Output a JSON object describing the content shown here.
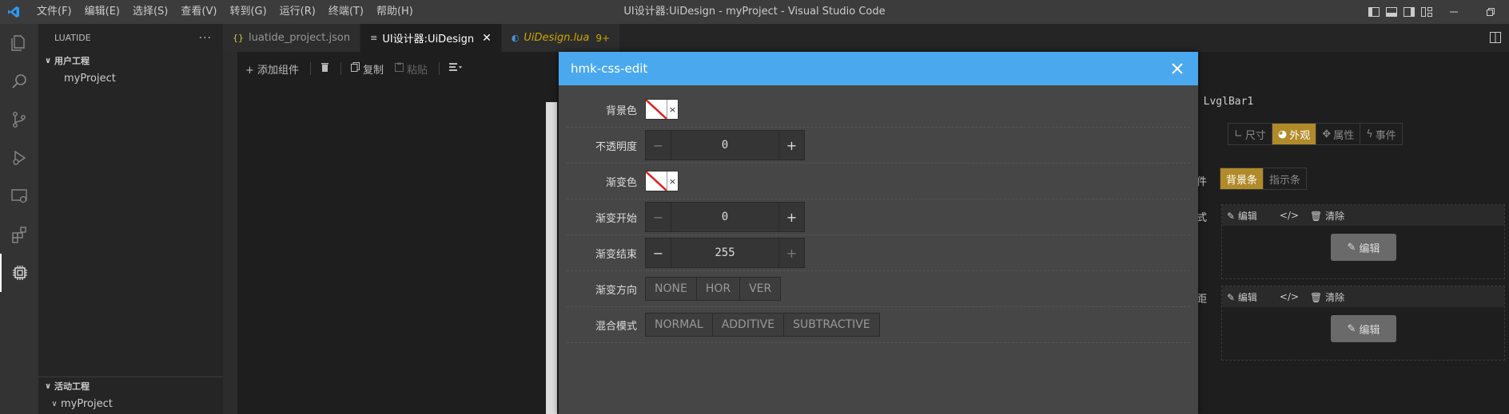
{
  "window": {
    "title": "UI设计器:UiDesign - myProject - Visual Studio Code"
  },
  "menu": [
    "文件(F)",
    "编辑(E)",
    "选择(S)",
    "查看(V)",
    "转到(G)",
    "运行(R)",
    "终端(T)",
    "帮助(H)"
  ],
  "sidebar": {
    "header": "LUATIDE",
    "more": "···",
    "section1": "用户工程",
    "project1": "myProject",
    "section2": "活动工程",
    "project2": "myProject"
  },
  "tabs": [
    {
      "icon": "{}",
      "label": "luatide_project.json"
    },
    {
      "icon": "≡",
      "label": "UI设计器:UiDesign",
      "close": "✕"
    },
    {
      "icon": "◐",
      "label": "UiDesign.lua",
      "badge": "9+"
    }
  ],
  "toolbar": {
    "add": "+ 添加组件",
    "copy": "复制",
    "paste": "粘贴"
  },
  "right_panel": {
    "title": ": LvglBar1",
    "tabs": [
      "尺寸",
      "外观",
      "属性",
      "事件"
    ],
    "active_tab": "外观",
    "part_label": "件",
    "parts": [
      "背景条",
      "指示条"
    ],
    "active_part": "背景条",
    "style_label": "式",
    "pad_label": "距",
    "bar_edit": "编辑",
    "bar_code": "</>",
    "bar_clear": "清除",
    "edit_btn": "编辑"
  },
  "modal": {
    "title": "hmk-css-edit",
    "rows": {
      "bg_color": "背景色",
      "opacity": "不透明度",
      "grad_color": "渐变色",
      "grad_start": "渐变开始",
      "grad_end": "渐变结束",
      "grad_dir": "渐变方向",
      "blend_mode": "混合模式"
    },
    "values": {
      "opacity": "0",
      "grad_start": "0",
      "grad_end": "255"
    },
    "swatch_clear": "×",
    "minus": "−",
    "plus": "+",
    "grad_dir_options": [
      "NONE",
      "HOR",
      "VER"
    ],
    "blend_options": [
      "NORMAL",
      "ADDITIVE",
      "SUBTRACTIVE"
    ]
  },
  "colors": {
    "accent": "#4aa8ee",
    "active_gold": "#b18a2a"
  }
}
